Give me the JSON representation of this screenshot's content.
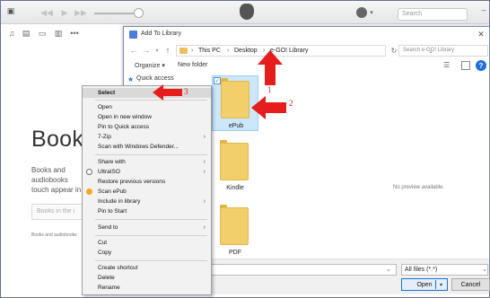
{
  "itunes": {
    "search_placeholder": "Search",
    "books": {
      "title": "Books",
      "description": "Books and audiobooks touch appear in t",
      "button_label": "Books in the i",
      "footnote": "Books and audiobooks"
    }
  },
  "dialog": {
    "title": "Add To Library",
    "breadcrumbs": [
      "This PC",
      "Desktop",
      "e-GO! Library"
    ],
    "search_placeholder": "Search e-GO! Library",
    "toolbar": {
      "organize": "Organize ▾",
      "new_folder": "New folder"
    },
    "nav": {
      "quick_access": "Quick access"
    },
    "files": [
      {
        "name": "ePub",
        "selected": true
      },
      {
        "name": "Kindle",
        "selected": false
      },
      {
        "name": "PDF",
        "selected": false
      }
    ],
    "preview_text": "No preview available.",
    "file_type": "All files (*.*)",
    "open_label": "Open",
    "cancel_label": "Cancel"
  },
  "context_menu": {
    "items": [
      {
        "label": "Select",
        "bold": true,
        "hover": true
      },
      {
        "label": "Open"
      },
      {
        "label": "Open in new window"
      },
      {
        "label": "Pin to Quick access"
      },
      {
        "label": "7-Zip",
        "submenu": true
      },
      {
        "label": "Scan with Windows Defender..."
      },
      {
        "label": "Share with",
        "submenu": true
      },
      {
        "label": "UltraISO",
        "submenu": true,
        "icon": "ultraiso"
      },
      {
        "label": "Restore previous versions"
      },
      {
        "label": "Scan ePub",
        "icon": "scan"
      },
      {
        "label": "Include in library",
        "submenu": true
      },
      {
        "label": "Pin to Start"
      },
      {
        "label": "Send to",
        "submenu": true
      },
      {
        "label": "Cut"
      },
      {
        "label": "Copy"
      },
      {
        "label": "Create shortcut"
      },
      {
        "label": "Delete"
      },
      {
        "label": "Rename"
      }
    ]
  },
  "annotations": {
    "step1": "1",
    "step2": "2",
    "step3": "3"
  },
  "colors": {
    "arrow": "#e51d1d",
    "accent": "#1b74d3",
    "folder": "#f2cf6a"
  }
}
